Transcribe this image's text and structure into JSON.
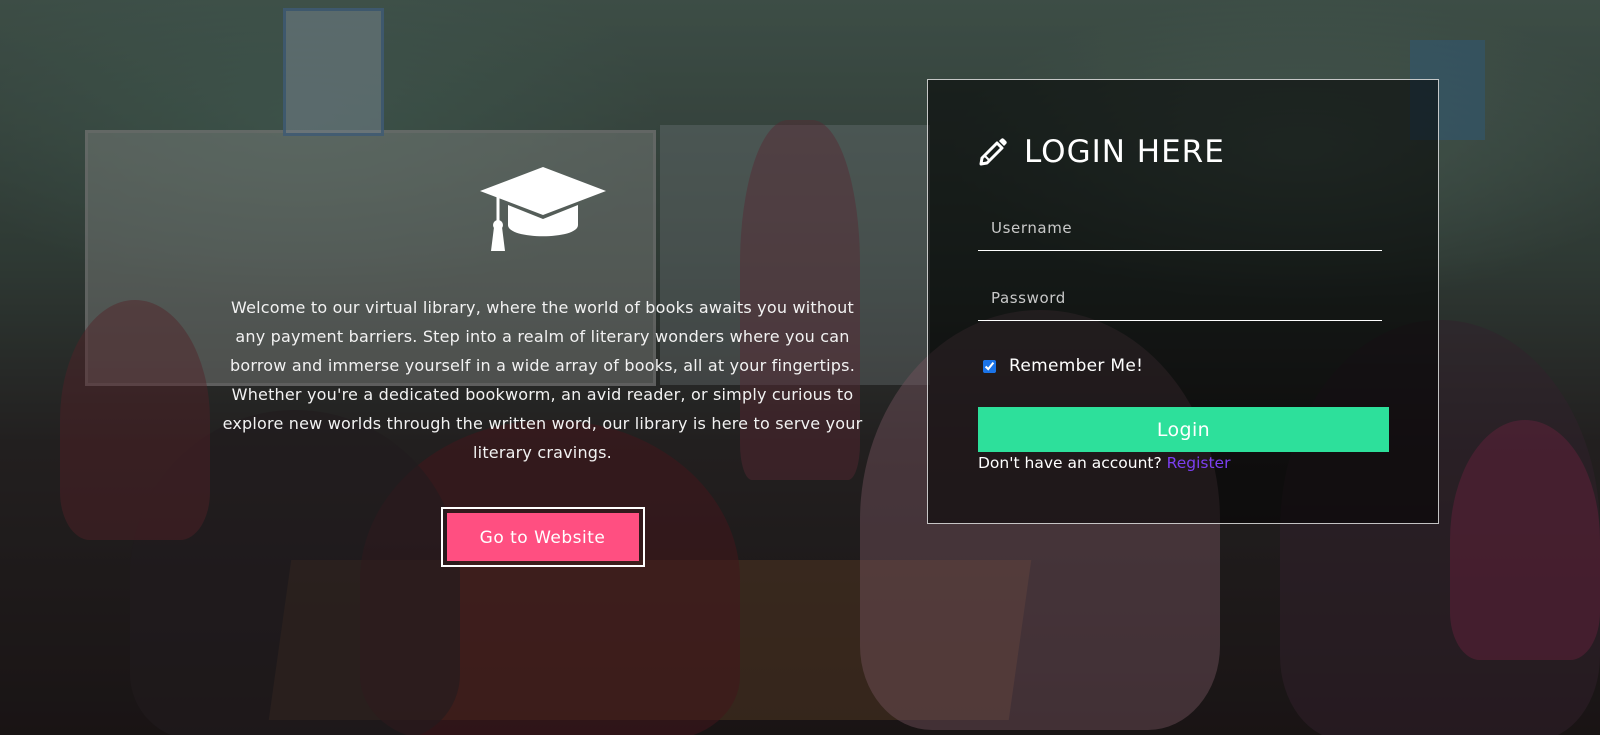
{
  "hero": {
    "icon": "graduation-cap-icon",
    "description": "Welcome to our virtual library, where the world of books awaits you without any payment barriers. Step into a realm of literary wonders where you can borrow and immerse yourself in a wide array of books, all at your fingertips. Whether you're a dedicated bookworm, an avid reader, or simply curious to explore new worlds through the written word, our library is here to serve your literary cravings.",
    "cta_label": "Go to Website"
  },
  "login": {
    "icon": "pencil-icon",
    "title": "LOGIN HERE",
    "username_placeholder": "Username",
    "password_placeholder": "Password",
    "remember_label": "Remember Me!",
    "remember_checked": true,
    "button_label": "Login",
    "no_account_text": "Don't have an account?",
    "register_label": "Register"
  },
  "colors": {
    "cta": "#ff4f81",
    "login_button": "#2de09b",
    "register_link": "#7b3ff0"
  }
}
